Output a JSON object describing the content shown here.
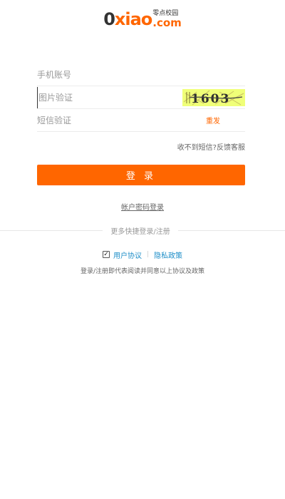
{
  "logo": {
    "part_zero": "0",
    "part_xiao": "xiao",
    "tag": "零点校园",
    "part_com": ".com"
  },
  "form": {
    "phone_placeholder": "手机账号",
    "captcha_placeholder": "图片验证",
    "captcha_code": "1603",
    "sms_placeholder": "短信验证",
    "resend_label": "重发"
  },
  "help_link": "收不到短信?反馈客服",
  "login_button": "登 录",
  "password_login_link": "帐户密码登录",
  "divider_text": "更多快捷登录/注册",
  "agreement": {
    "checked": true,
    "user_agreement": "用户协议",
    "separator": "|",
    "privacy_policy": "隐私政策",
    "notice": "登录/注册即代表阅读并同意以上协议及政策"
  },
  "colors": {
    "accent": "#ff6600",
    "link": "#1e8ec8",
    "captcha_bg": "#f0ff78"
  }
}
